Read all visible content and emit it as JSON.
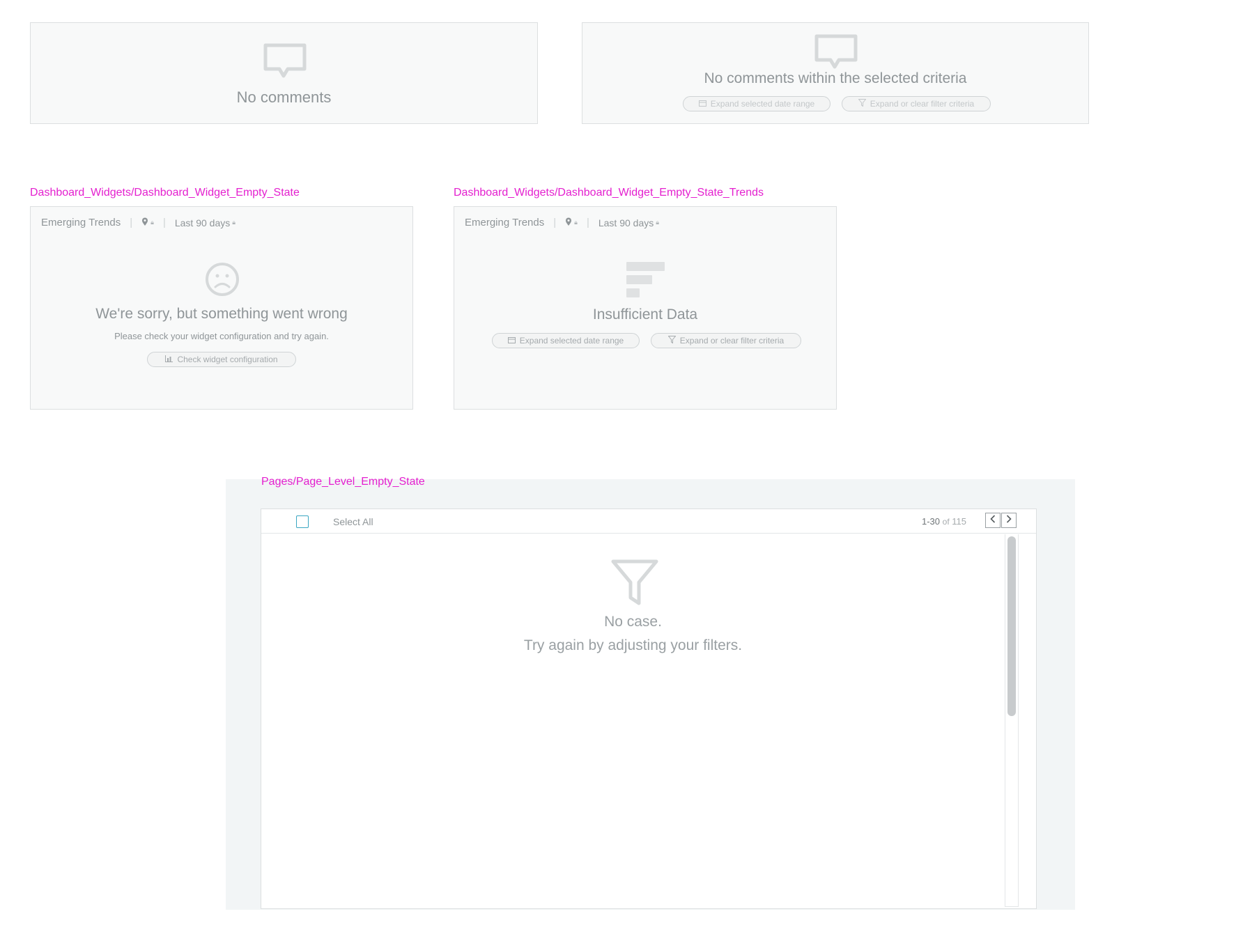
{
  "comments_empty": {
    "message": "No comments"
  },
  "comments_filtered": {
    "message": "No comments within the selected criteria",
    "date_button": "Expand selected date range",
    "filter_button": "Expand or clear filter criteria"
  },
  "widget_error": {
    "component_label": "Dashboard_Widgets/Dashboard_Widget_Empty_State",
    "title": "Emerging Trends",
    "period": "Last 90 days",
    "heading": "We're sorry, but something went wrong",
    "subtext": "Please check your widget configuration and try again.",
    "config_button": "Check widget configuration"
  },
  "widget_trends": {
    "component_label": "Dashboard_Widgets/Dashboard_Widget_Empty_State_Trends",
    "title": "Emerging Trends",
    "period": "Last 90 days",
    "heading": "Insufficient Data",
    "date_button": "Expand selected date range",
    "filter_button": "Expand or clear filter criteria"
  },
  "page_empty": {
    "component_label": "Pages/Page_Level_Empty_State",
    "select_all": "Select All",
    "range": "1-30",
    "of_label": "of",
    "total": "115",
    "heading": "No case.",
    "subtext": "Try again by adjusting your filters."
  },
  "colors": {
    "label_magenta": "#e41fcf",
    "checkbox_teal": "#3aa6c2",
    "panel_bg": "#f8f9f9",
    "page_bg": "#f2f5f6"
  }
}
